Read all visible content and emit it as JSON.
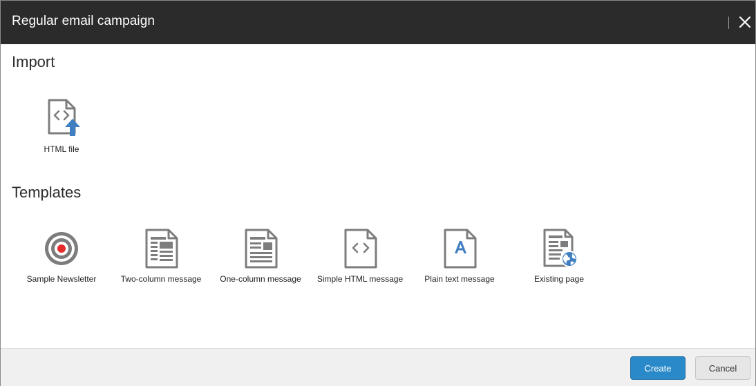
{
  "dialog": {
    "title": "Regular email campaign"
  },
  "import": {
    "heading": "Import",
    "items": [
      {
        "label": "HTML file",
        "icon": "html-file-upload-icon"
      }
    ]
  },
  "templates": {
    "heading": "Templates",
    "items": [
      {
        "label": "Sample Newsletter",
        "icon": "target-icon"
      },
      {
        "label": "Two-column message",
        "icon": "two-column-document-icon"
      },
      {
        "label": "One-column message",
        "icon": "one-column-document-icon"
      },
      {
        "label": "Simple HTML message",
        "icon": "html-document-icon"
      },
      {
        "label": "Plain text message",
        "icon": "text-document-icon"
      },
      {
        "label": "Existing page",
        "icon": "document-globe-icon"
      }
    ]
  },
  "footer": {
    "create_label": "Create",
    "cancel_label": "Cancel"
  },
  "colors": {
    "titlebar": "#2b2b2b",
    "accent": "#2a89c8",
    "icon_gray": "#7d7d7d",
    "icon_blue": "#3f7fc1",
    "target_red": "#e52b2b"
  }
}
